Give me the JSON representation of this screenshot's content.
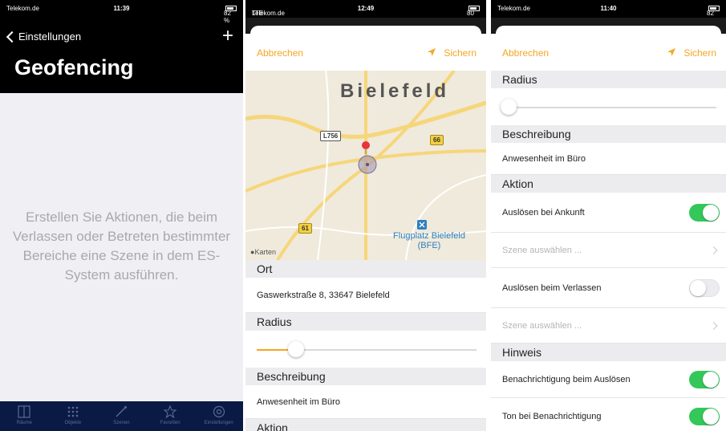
{
  "phone1": {
    "status": {
      "carrier": "Telekom.de",
      "time": "11:39",
      "battery": "82 %"
    },
    "back_label": "Einstellungen",
    "add_label": "+",
    "title": "Geofencing",
    "empty_message": "Erstellen Sie Aktionen, die beim Verlassen oder Betreten bestimmter Bereiche eine Szene in dem ES-System ausführen.",
    "tabs": [
      {
        "label": "Räume",
        "icon": "rooms-icon"
      },
      {
        "label": "Objekte",
        "icon": "grid-icon"
      },
      {
        "label": "Szenen",
        "icon": "wand-icon"
      },
      {
        "label": "Favoriten",
        "icon": "star-icon"
      },
      {
        "label": "Einstellungen",
        "icon": "gear-icon"
      }
    ]
  },
  "phone2": {
    "status": {
      "carrier": "Telekom.de",
      "network": "LTE",
      "time": "12:49",
      "battery": "80 %"
    },
    "cancel_label": "Abbrechen",
    "save_label": "Sichern",
    "map": {
      "city": "Bielefeld",
      "attribution": "Karten",
      "airport": "Flugplatz Bielefeld (BFE)",
      "road_labels": [
        "L756",
        "66",
        "61"
      ]
    },
    "ort_header": "Ort",
    "address": "Gaswerkstraße 8, 33647 Bielefeld",
    "radius_header": "Radius",
    "radius_value": 0.18,
    "description_header": "Beschreibung",
    "description": "Anwesenheit im Büro",
    "action_header": "Aktion"
  },
  "phone3": {
    "status": {
      "carrier": "Telekom.de",
      "time": "11:40",
      "battery": "82 %"
    },
    "cancel_label": "Abbrechen",
    "save_label": "Sichern",
    "radius_header": "Radius",
    "radius_value": 0.0,
    "description_header": "Beschreibung",
    "description": "Anwesenheit im Büro",
    "action_header": "Aktion",
    "trigger_arrival": "Auslösen bei Ankunft",
    "scene_select_1": "Szene auswählen ...",
    "trigger_leave": "Auslösen beim Verlassen",
    "scene_select_2": "Szene auswählen ...",
    "hint_header": "Hinweis",
    "notify_trigger": "Benachrichtigung beim Auslösen",
    "notify_sound": "Ton bei Benachrichtigung",
    "colors": {
      "accent": "#f5a623",
      "toggle_on": "#34c759"
    }
  }
}
